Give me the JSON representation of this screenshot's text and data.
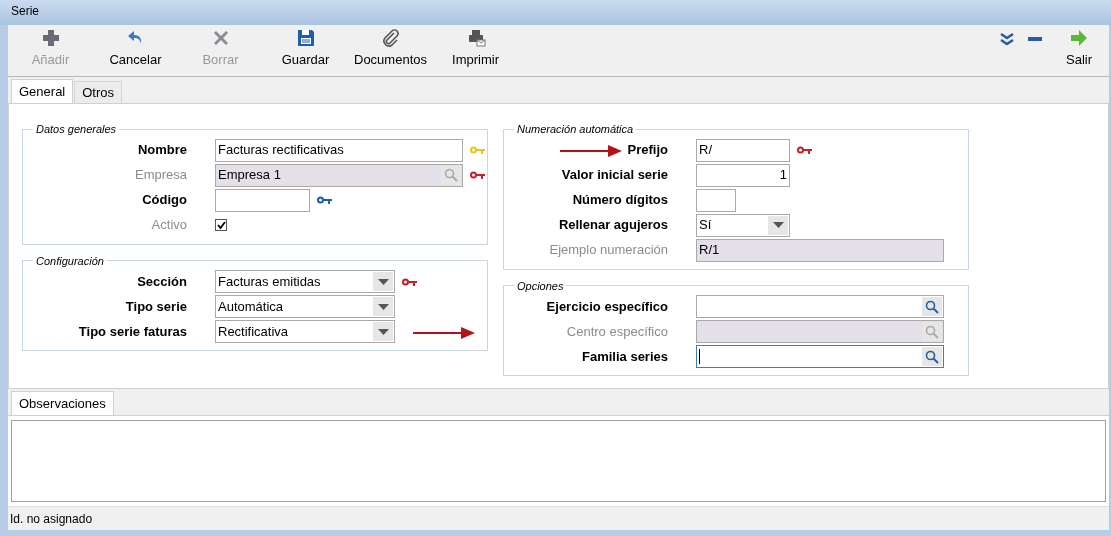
{
  "window": {
    "title": "Serie"
  },
  "toolbar": [
    {
      "label": "Añadir",
      "kind": "add",
      "disabled": true
    },
    {
      "label": "Cancelar",
      "kind": "undo",
      "disabled": false
    },
    {
      "label": "Borrar",
      "kind": "delete",
      "disabled": true
    },
    {
      "label": "Guardar",
      "kind": "save",
      "disabled": false
    },
    {
      "label": "Documentos",
      "kind": "attach",
      "disabled": false
    },
    {
      "label": "Imprimir",
      "kind": "print",
      "disabled": false
    }
  ],
  "toolbar_right": [
    {
      "kind": "expand"
    },
    {
      "kind": "minimize"
    },
    {
      "kind": "exit",
      "label": "Salir"
    }
  ],
  "tabs": [
    {
      "label": "General",
      "selected": true
    },
    {
      "label": "Otros",
      "selected": false
    }
  ],
  "groups": [
    {
      "title": "Datos generales",
      "fields": [
        {
          "label": "Nombre",
          "kind": "text",
          "value": "Facturas rectificativas",
          "disabled": false,
          "pointed": false,
          "color": "#e6c619"
        },
        {
          "label": "Empresa",
          "kind": "lookup",
          "value": "Empresa 1",
          "disabled": true,
          "pointed": false,
          "color": "#c8202a"
        },
        {
          "label": "Código",
          "kind": "text",
          "disabled": false,
          "pointed": false,
          "color": "#1a5fa8"
        },
        {
          "label": "Activo",
          "kind": "checkbox",
          "checked": true,
          "disabled": true,
          "pointed": false
        }
      ]
    },
    {
      "title": "Configuración",
      "fields": [
        {
          "label": "Sección",
          "kind": "select",
          "value": "Facturas emitidas",
          "disabled": false,
          "pointed": false,
          "color": "#c8202a"
        },
        {
          "label": "Tipo serie",
          "kind": "select",
          "value": "Automática",
          "disabled": false,
          "pointed": false
        },
        {
          "label": "Tipo serie faturas",
          "kind": "select",
          "value": "Rectificativa",
          "disabled": false,
          "pointed": true
        }
      ]
    },
    {
      "title": "Numeración automática",
      "fields": [
        {
          "label": "Prefijo",
          "kind": "text",
          "value": "R/",
          "disabled": false,
          "pointed": true,
          "color": "#c8202a"
        },
        {
          "label": "Valor inicial serie",
          "kind": "number",
          "value": "1",
          "disabled": false,
          "pointed": false
        },
        {
          "label": "Número dígitos",
          "kind": "number",
          "disabled": false,
          "pointed": false
        },
        {
          "label": "Rellenar agujeros",
          "kind": "select",
          "value": "Sí",
          "disabled": false,
          "pointed": false
        },
        {
          "label": "Ejemplo numeración",
          "kind": "text",
          "value": "R/1",
          "disabled": true,
          "pointed": false
        }
      ]
    },
    {
      "title": "Opciones",
      "fields": [
        {
          "label": "Ejercicio específico",
          "kind": "lookup",
          "disabled": false,
          "pointed": false
        },
        {
          "label": "Centro específico",
          "kind": "lookup",
          "disabled": true,
          "pointed": false
        },
        {
          "label": "Familia series",
          "kind": "lookup",
          "disabled": false,
          "pointed": false,
          "focused": true
        }
      ]
    }
  ],
  "notes_tab": {
    "label": "Observaciones",
    "selected": true
  },
  "status_bar": "Id. no asignado"
}
